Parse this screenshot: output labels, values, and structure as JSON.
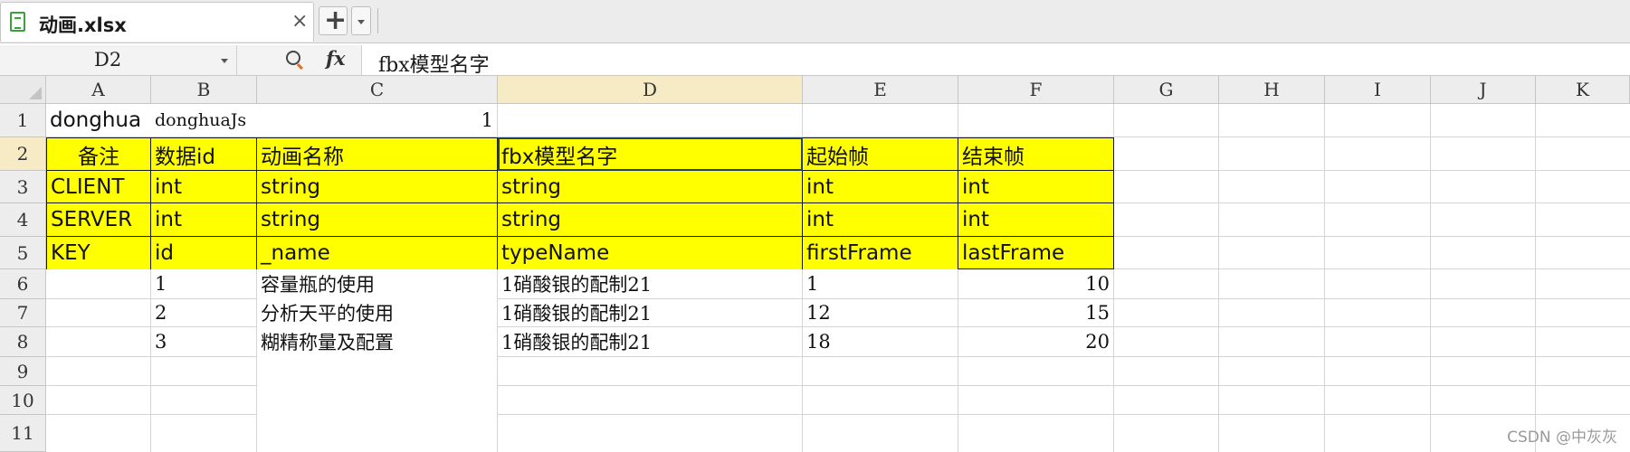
{
  "tab": {
    "title": "动画.xlsx",
    "close": "×",
    "new": "+"
  },
  "formula_bar": {
    "cell_ref": "D2",
    "fx": "fx",
    "content": "fbx模型名字"
  },
  "columns": [
    "A",
    "B",
    "C",
    "D",
    "E",
    "F",
    "G",
    "H",
    "I",
    "J",
    "K"
  ],
  "rows": [
    "1",
    "2",
    "3",
    "4",
    "5",
    "6",
    "7",
    "8",
    "9",
    "10",
    "11"
  ],
  "cells": {
    "r1": {
      "a": "donghua",
      "b": "donghuaJs",
      "c": "1"
    },
    "r2": {
      "a": "备注",
      "b": "数据id",
      "c": "动画名称",
      "d": "fbx模型名字",
      "e": "起始帧",
      "f": "结束帧"
    },
    "r3": {
      "a": "CLIENT",
      "b": "int",
      "c": "string",
      "d": "string",
      "e": "int",
      "f": "int"
    },
    "r4": {
      "a": "SERVER",
      "b": "int",
      "c": "string",
      "d": "string",
      "e": "int",
      "f": "int"
    },
    "r5": {
      "a": "KEY",
      "b": "id",
      "c": "_name",
      "d": "typeName",
      "e": "firstFrame",
      "f": "lastFrame"
    },
    "r6": {
      "b": "1",
      "c": "容量瓶的使用",
      "d": "1硝酸银的配制21",
      "e": "1",
      "f": "10"
    },
    "r7": {
      "b": "2",
      "c": "分析天平的使用",
      "d": "1硝酸银的配制21",
      "e": "12",
      "f": "15"
    },
    "r8": {
      "b": "3",
      "c": "糊精称量及配置",
      "d": "1硝酸银的配制21",
      "e": "18",
      "f": "20"
    }
  },
  "colors": {
    "header_fill": "#ffff00",
    "selection_border": "#1f3c6e",
    "active_header": "#f7ebc6"
  },
  "watermark": "CSDN @中灰灰"
}
